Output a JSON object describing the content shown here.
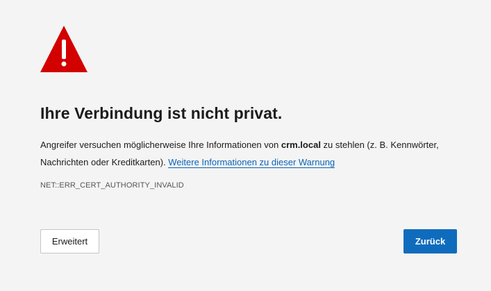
{
  "icon": {
    "name": "warning-triangle-icon",
    "color": "#d30000"
  },
  "title": "Ihre Verbindung ist nicht privat.",
  "description": {
    "before_domain": "Angreifer versuchen möglicherweise Ihre Informationen von ",
    "domain": "crm.local",
    "after_domain": " zu stehlen (z. B. Kennwörter, Nachrichten oder Kreditkarten). ",
    "link_text": "Weitere Informationen zu dieser Warnung"
  },
  "error_code": "NET::ERR_CERT_AUTHORITY_INVALID",
  "buttons": {
    "advanced_label": "Erweitert",
    "back_label": "Zurück"
  },
  "colors": {
    "background": "#f4f4f4",
    "accent": "#0f6cbd",
    "link": "#0c63b7",
    "warning": "#d30000"
  }
}
